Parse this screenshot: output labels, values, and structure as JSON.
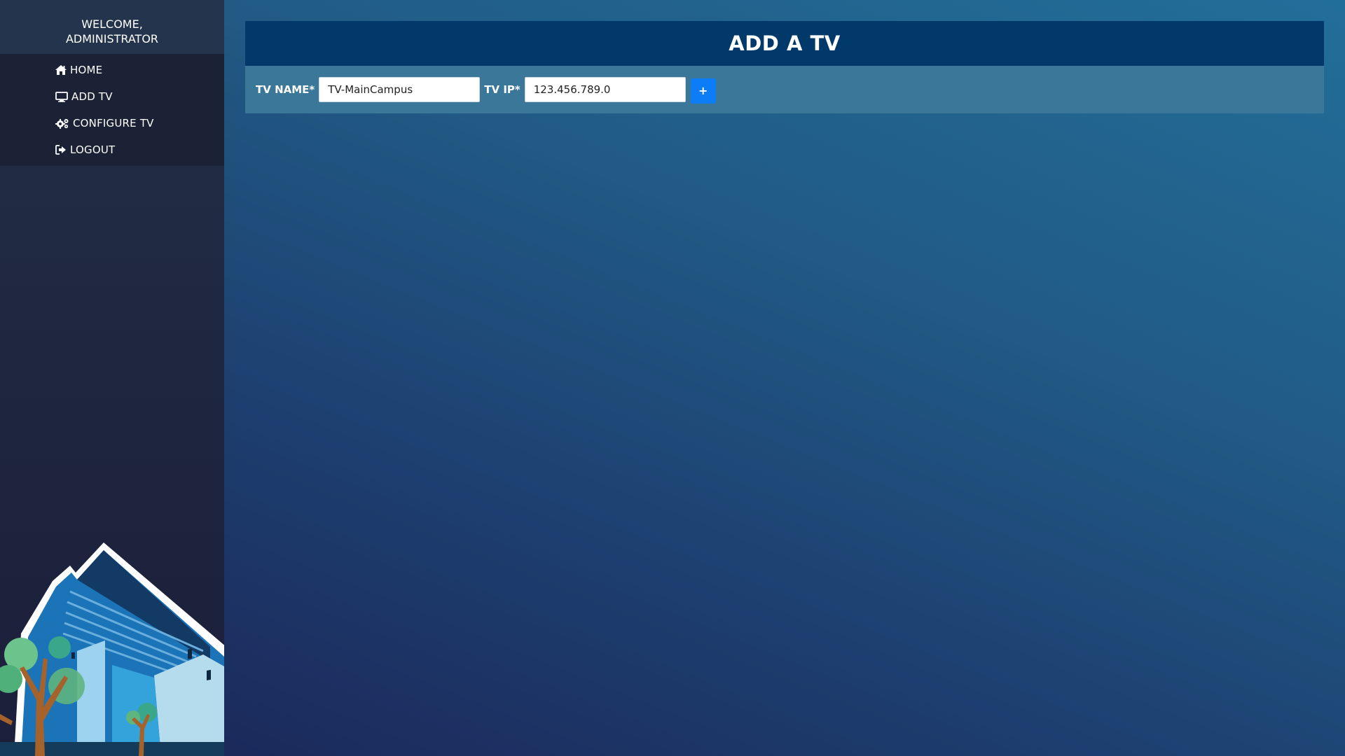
{
  "sidebar": {
    "welcome_line1": "WELCOME,",
    "welcome_line2": "ADMINISTRATOR",
    "items": [
      {
        "label": "HOME",
        "icon": "home-icon"
      },
      {
        "label": "ADD TV",
        "icon": "monitor-icon"
      },
      {
        "label": "CONFIGURE TV",
        "icon": "gears-icon"
      },
      {
        "label": "LOGOUT",
        "icon": "sign-out-icon"
      }
    ]
  },
  "main": {
    "title": "ADD A TV",
    "form": {
      "tv_name_label": "TV NAME*",
      "tv_name_value": "TV-MainCampus",
      "tv_ip_label": "TV IP*",
      "tv_ip_value": "123.456.789.0",
      "add_button_label": "+"
    }
  },
  "colors": {
    "header_bg": "#01396a",
    "form_bar_bg": "#3a7798",
    "button_accent": "#0d7cf7",
    "sidebar_bg": "#1f2740"
  }
}
